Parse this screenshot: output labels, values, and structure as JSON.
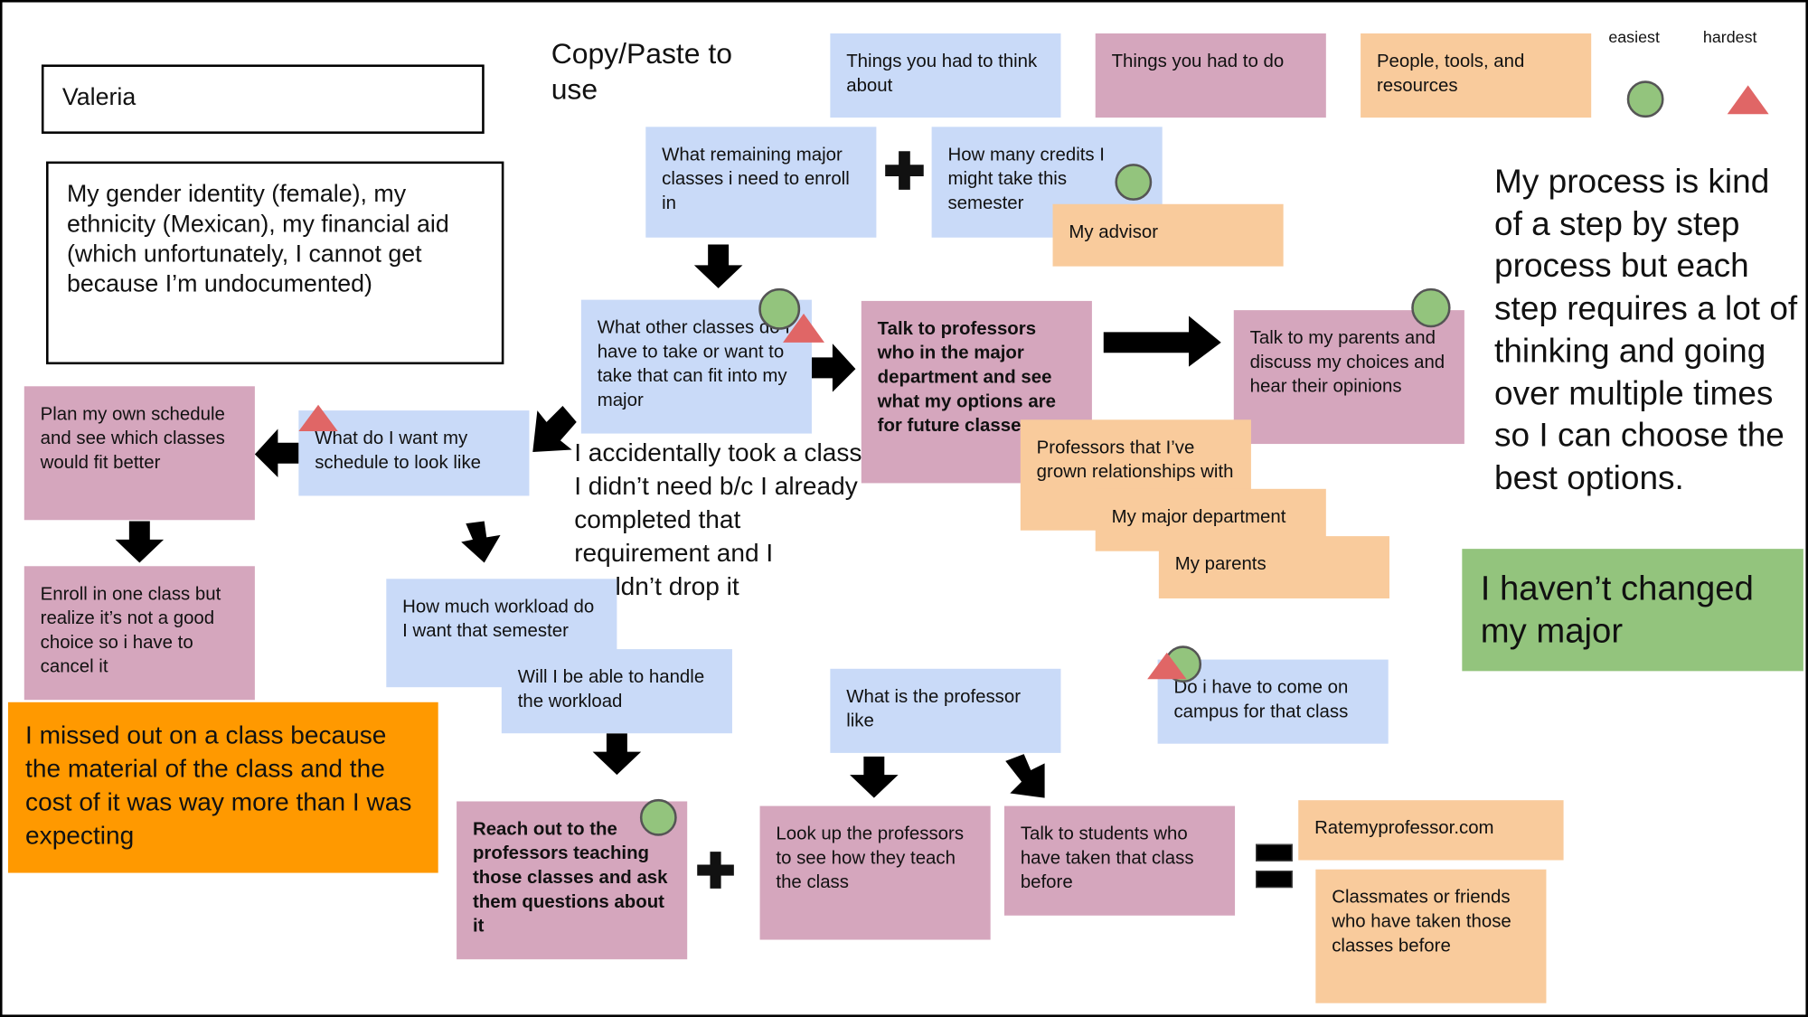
{
  "name": "Valeria",
  "identity": "My gender identity (female), my ethnicity (Mexican), my financial aid (which unfortunately, I cannot get because I’m undocumented)",
  "copy_paste": "Copy/Paste to use",
  "legend": {
    "think": "Things you had to think about",
    "do": "Things you had to do",
    "people": "People, tools, and resources",
    "easiest": "easiest",
    "hardest": "hardest",
    "colors": {
      "think": "#c9daf8",
      "do": "#d5a6bd",
      "people": "#f9cb9c",
      "easiest": "#93c47d",
      "hardest": "#e06666"
    }
  },
  "notes": {
    "remaining": "What remaining major classes i need to enroll in",
    "credits": "How many credits I might take this semester",
    "advisor": "My advisor",
    "other_classes": "What other classes do I have to take or want to take that can fit into my major",
    "talk_professors": "Talk to professors who in the major department and see what my options are for future classes",
    "talk_parents": "Talk to my parents and discuss my choices and hear their opinions",
    "professors_rel": "Professors that I’ve grown relationships with",
    "major_dept": "My major department",
    "parents": "My parents",
    "plan": "Plan my own schedule and see which classes would fit better",
    "schedule_look": "What do I want my schedule to look like",
    "accident": "I accidentally took a class I didn’t need b/c I already completed that requirement and I couldn’t drop it",
    "enroll": "Enroll in one class but realize it’s not a good choice so i have to cancel it",
    "workload": "How much workload do I want that semester",
    "handle": "Will I be able to handle the workload",
    "missed": "I missed out on a class because the material of the class and the cost of it was way more than I was expecting",
    "professor_like": "What is the professor like",
    "campus": "Do i have to come on campus for that class",
    "reach_out": "Reach out to the professors teaching those classes and ask them questions about it",
    "look_up": "Look up the professors to see how they teach the class",
    "talk_students": "Talk to students who have taken that class before",
    "rmp": "Ratemyprofessor.com",
    "classmates": "Classmates or friends who have taken those classes before",
    "process": "My process is kind of a step by step process but each step requires a lot of thinking and going over multiple times so I can choose the best options.",
    "major": "I haven’t changed my major"
  }
}
